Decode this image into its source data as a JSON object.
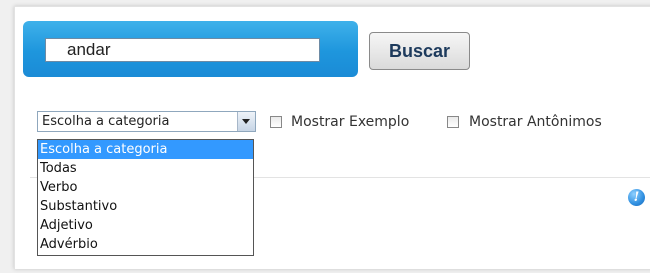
{
  "search": {
    "value": "andar",
    "button_label": "Buscar"
  },
  "category": {
    "selected_label": "Escolha a categoria",
    "options": [
      "Escolha a categoria",
      "Todas",
      "Verbo",
      "Substantivo",
      "Adjetivo",
      "Advérbio"
    ]
  },
  "checkboxes": {
    "show_example": "Mostrar Exemplo",
    "show_antonyms": "Mostrar Antônimos"
  },
  "icons": {
    "info": "info-icon",
    "dropdown": "chevron-down-icon"
  },
  "colors": {
    "search_bar": "#1e96dd",
    "button_text": "#1d3a5c",
    "option_highlight": "#3399ff"
  }
}
